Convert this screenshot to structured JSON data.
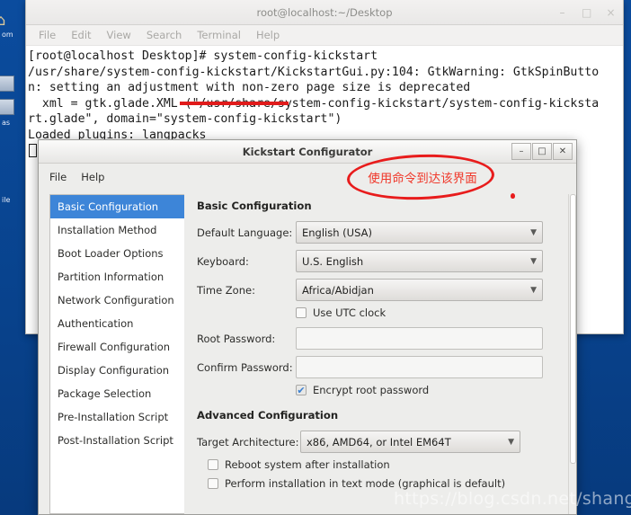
{
  "desktop": {
    "background_color": "#0a4a9e",
    "icons": [
      {
        "name": "home-folder-icon",
        "glyph": "⌂",
        "label": "om"
      },
      {
        "name": "files-icon",
        "glyph": "",
        "label": ""
      },
      {
        "name": "files-icon-2",
        "glyph": "",
        "label": "as"
      },
      {
        "name": "file-icon-3",
        "glyph": "",
        "label": "ile"
      }
    ]
  },
  "terminal": {
    "title": "root@localhost:~/Desktop",
    "menu": [
      "File",
      "Edit",
      "View",
      "Search",
      "Terminal",
      "Help"
    ],
    "window_controls": {
      "minimize": "–",
      "maximize": "□",
      "close": "×"
    },
    "lines": [
      "[root@localhost Desktop]# system-config-kickstart",
      "/usr/share/system-config-kickstart/KickstartGui.py:104: GtkWarning: GtkSpinButto",
      "n: setting an adjustment with non-zero page size is deprecated",
      "  xml = gtk.glade.XML (\"/usr/share/system-config-kickstart/system-config-kicksta",
      "rt.glade\", domain=\"system-config-kickstart\")",
      "Loaded plugins: langpacks"
    ]
  },
  "kickstart": {
    "title": "Kickstart Configurator",
    "menu": [
      "File",
      "Help"
    ],
    "window_controls": {
      "minimize": "–",
      "maximize": "□",
      "close": "✕"
    },
    "sidebar": {
      "selected_index": 0,
      "items": [
        "Basic Configuration",
        "Installation Method",
        "Boot Loader Options",
        "Partition Information",
        "Network Configuration",
        "Authentication",
        "Firewall Configuration",
        "Display Configuration",
        "Package Selection",
        "Pre-Installation Script",
        "Post-Installation Script"
      ]
    },
    "basic": {
      "heading": "Basic Configuration",
      "default_language_label": "Default Language:",
      "default_language_value": "English (USA)",
      "keyboard_label": "Keyboard:",
      "keyboard_value": "U.S. English",
      "timezone_label": "Time Zone:",
      "timezone_value": "Africa/Abidjan",
      "use_utc_label": "Use UTC clock",
      "use_utc_checked": false,
      "root_password_label": "Root Password:",
      "root_password_value": "",
      "confirm_password_label": "Confirm Password:",
      "confirm_password_value": "",
      "encrypt_label": "Encrypt root password",
      "encrypt_checked": true
    },
    "advanced": {
      "heading": "Advanced Configuration",
      "target_arch_label": "Target Architecture:",
      "target_arch_value": "x86, AMD64, or Intel EM64T",
      "reboot_label": "Reboot system after installation",
      "reboot_checked": false,
      "textmode_label": "Perform installation in text mode (graphical is default)",
      "textmode_checked": false
    }
  },
  "annotations": {
    "ellipse_text": "使用命令到达该界面",
    "underline_target": "system-config-kickstart",
    "color": "#e81c1c"
  },
  "watermark": {
    "text": "https://blog.csdn.net/shang_feng_wei"
  }
}
